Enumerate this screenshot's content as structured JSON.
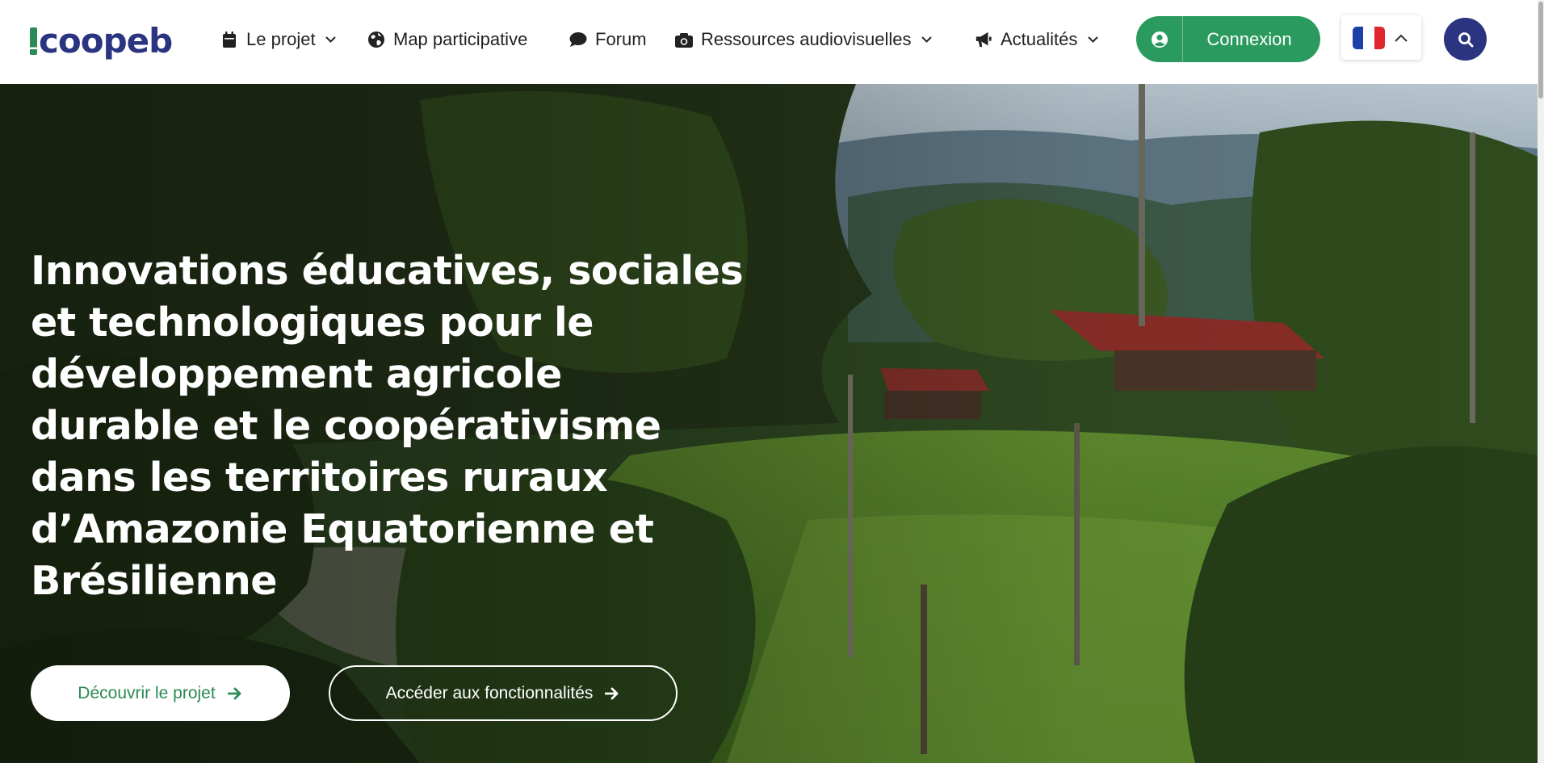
{
  "brand": {
    "name": "coopeb",
    "primary_color": "#2b3480",
    "accent_color": "#2b9a5e"
  },
  "nav": {
    "items": [
      {
        "label": "Le projet",
        "icon": "calendar-icon",
        "has_dropdown": true
      },
      {
        "label": "Map participative",
        "icon": "globe-icon",
        "has_dropdown": false
      },
      {
        "label": "Forum",
        "icon": "chat-icon",
        "has_dropdown": false
      },
      {
        "label": "Ressources audiovisuelles",
        "icon": "camera-icon",
        "has_dropdown": true
      },
      {
        "label": "Actualités",
        "icon": "megaphone-icon",
        "has_dropdown": true
      }
    ],
    "login_label": "Connexion",
    "language": {
      "icon": "flag-fr-icon",
      "colors": [
        "#1f3fa8",
        "#ffffff",
        "#e0262e"
      ]
    },
    "search_icon": "search-icon"
  },
  "hero": {
    "title_lines": [
      "Innovations éducatives, sociales",
      "et technologiques pour le",
      "développement agricole",
      "durable et le coopérativisme",
      "dans les territoires ruraux",
      "d’Amazonie Equatorienne et",
      "Brésilienne"
    ],
    "primary_button": "Découvrir le projet",
    "secondary_button": "Accéder aux fonctionnalités"
  }
}
